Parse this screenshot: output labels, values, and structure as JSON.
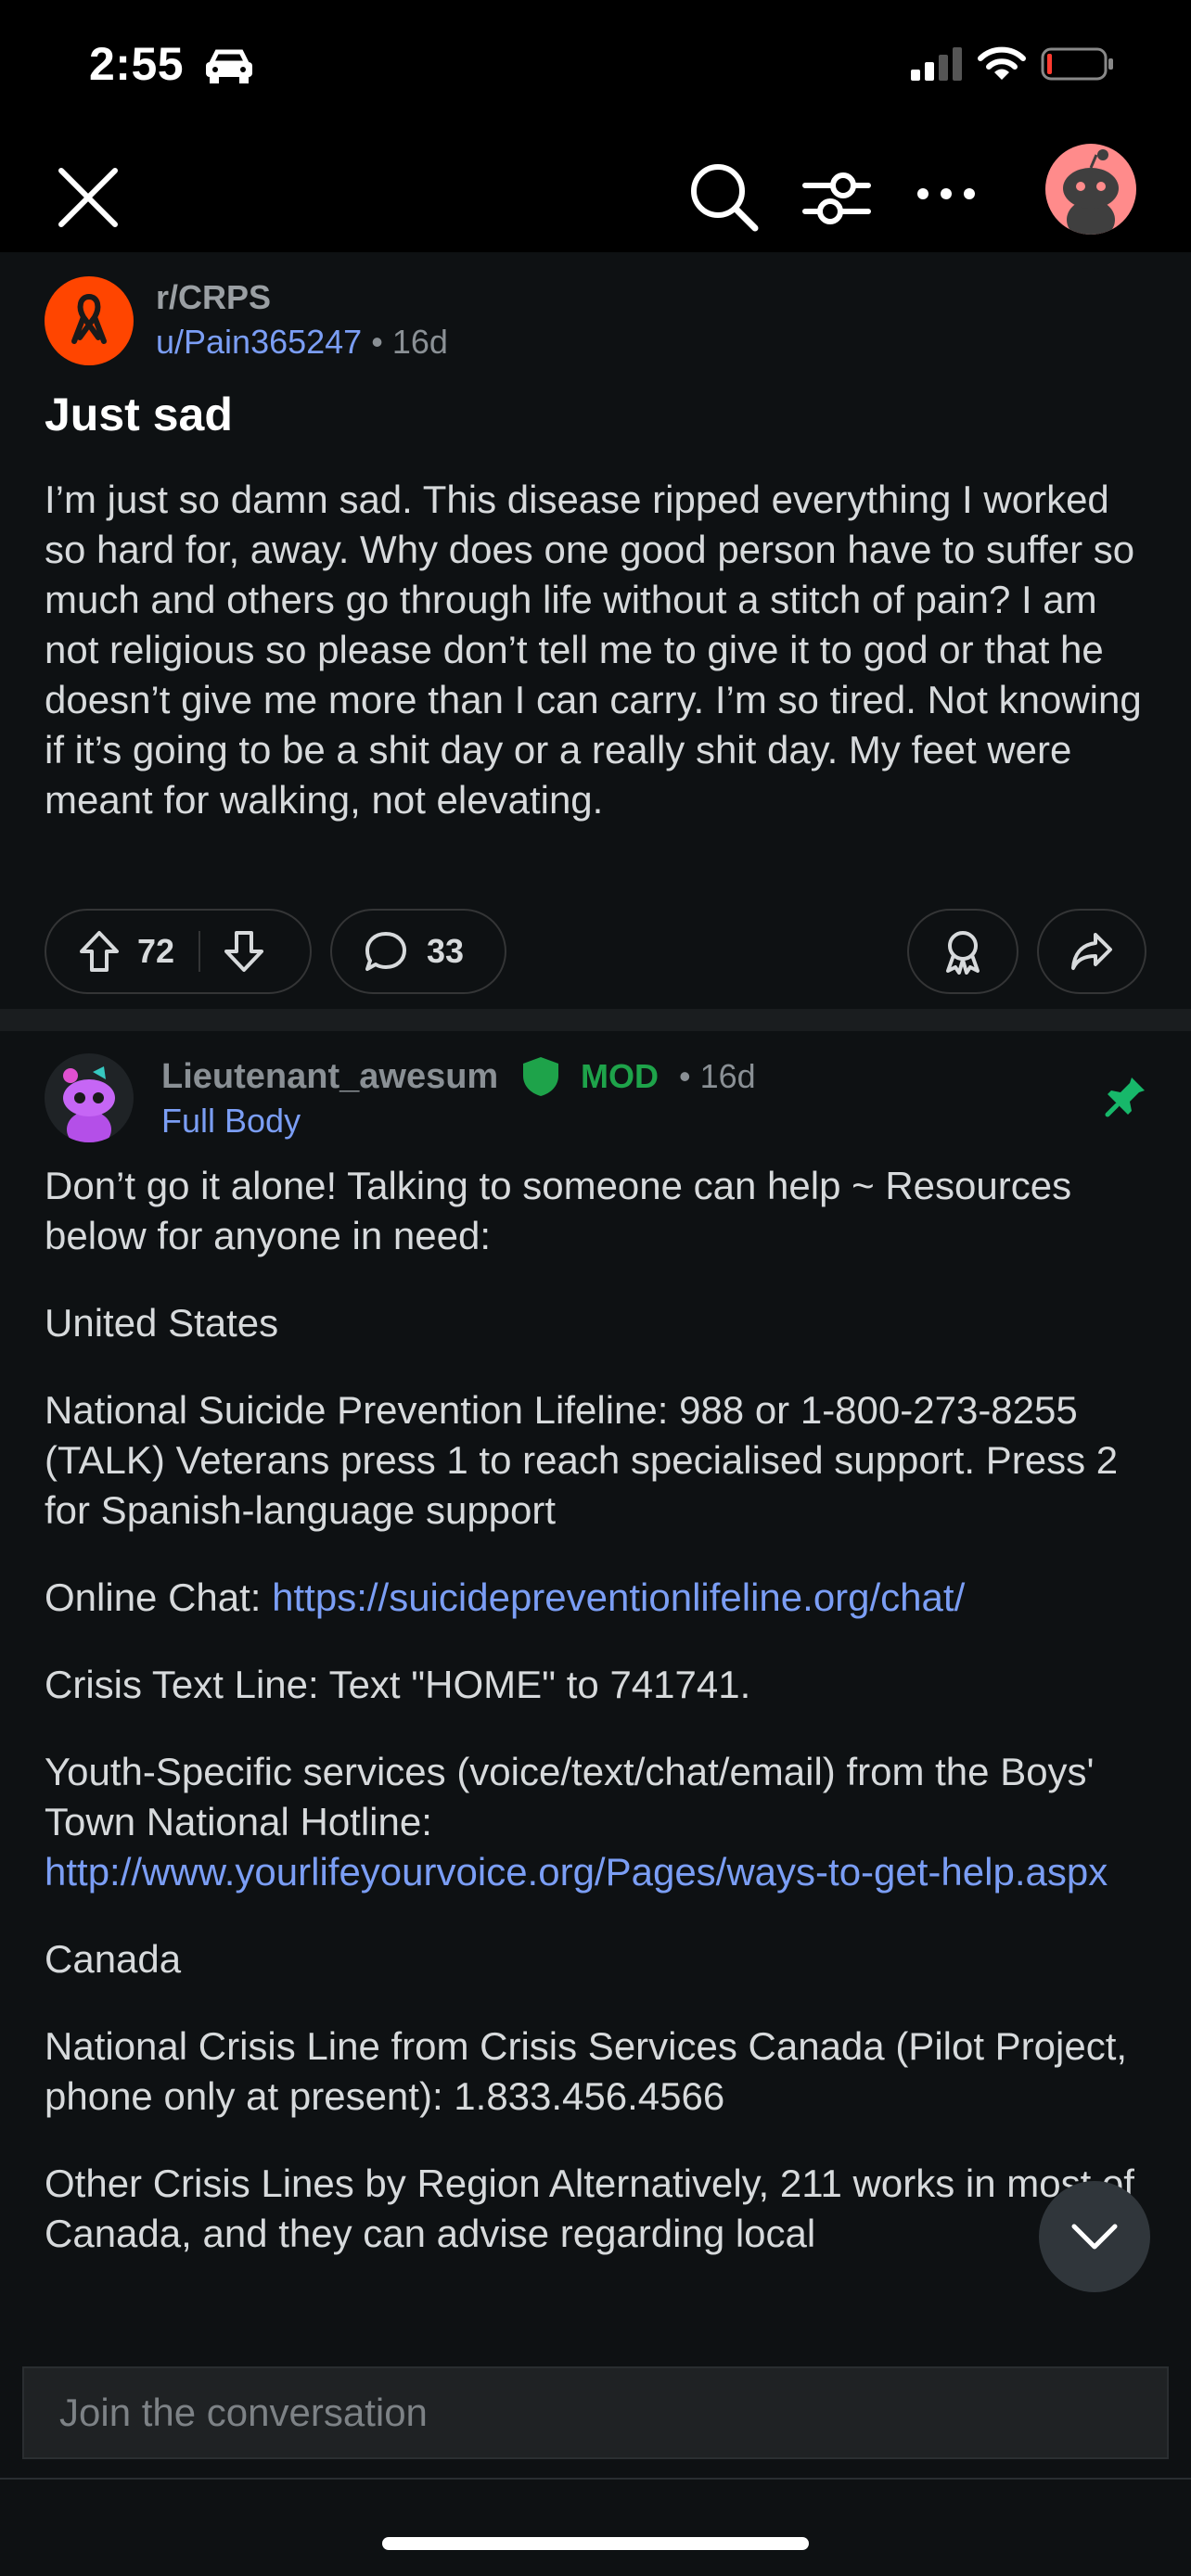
{
  "status_bar": {
    "time": "2:55"
  },
  "nav": {
    "icons": [
      "close-icon",
      "search-icon",
      "filter-icon",
      "more-icon",
      "avatar"
    ]
  },
  "post": {
    "subreddit": "r/CRPS",
    "author": "u/Pain365247",
    "separator": "•",
    "age": "16d",
    "title": "Just sad",
    "body": "I’m just so damn sad.  This disease ripped everything I worked so hard for, away.  Why does one good person have to suffer so much and others go through life without a stitch of pain?  I am not religious so please don’t tell me to give it to god or that he doesn’t give me more than I can carry.  I’m so tired.  Not knowing if it’s going to be a shit day or a really shit day.  My feet were meant for walking, not elevating.",
    "votes": "72",
    "comments": "33"
  },
  "comment": {
    "author": "Lieutenant_awesum",
    "badge": "MOD",
    "separator": "•",
    "age": "16d",
    "flair": "Full Body",
    "p1": "Don’t go it alone! Talking to someone can help ~ Resources below for anyone in need:",
    "p2": "United States",
    "p3": "National Suicide Prevention Lifeline: 988 or 1-800-273-8255 (TALK) Veterans press 1 to reach specialised support. Press 2 for Spanish-language support",
    "p4_prefix": "Online Chat: ",
    "p4_link": "https://suicidepreventionlifeline.org/chat/",
    "p5": "Crisis Text Line: Text \"HOME\" to 741741.",
    "p6_prefix": "Youth-Specific services (voice/text/chat/email) from the Boys' Town National Hotline: ",
    "p6_link": "http://www.yourlifeyourvoice.org/Pages/ways-to-get-help.aspx",
    "p7": "Canada",
    "p8": "National Crisis Line from Crisis Services Canada (Pilot Project, phone only at present): 1.833.456.4566",
    "p9": "Other Crisis Lines by Region Alternatively, 211 works in most of Canada, and they can advise regarding local"
  },
  "composer": {
    "placeholder": "Join the conversation"
  },
  "colors": {
    "accent_link": "#7b9ef5",
    "mod_green": "#1ea34a",
    "subreddit_orange": "#ff4500"
  }
}
